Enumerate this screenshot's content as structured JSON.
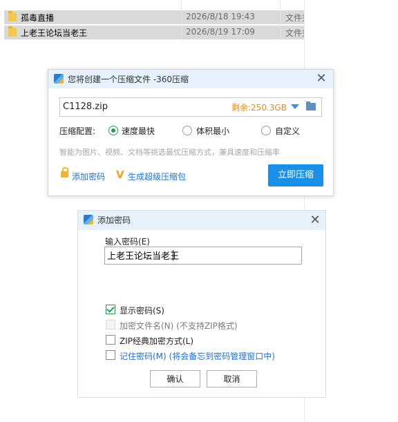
{
  "file_list": {
    "rows": [
      {
        "name": "孤毒直播",
        "date": "2026/8/18 19:43",
        "type": "文件夹"
      },
      {
        "name": "上老王论坛当老王",
        "date": "2026/8/19 17:09",
        "type": "文件夹"
      }
    ]
  },
  "compress_dialog": {
    "title": "您将创建一个压缩文件 -360压缩",
    "filename": "C1128.zip",
    "space_left": "剩余:250.3GB",
    "config_label": "压缩配置:",
    "options": [
      {
        "label": "速度最快",
        "selected": true
      },
      {
        "label": "体积最小",
        "selected": false
      },
      {
        "label": "自定义",
        "selected": false
      }
    ],
    "hint": "智能为图片、视频、文档等挑选最优压缩方式，兼具速度和压缩率",
    "add_password_link": "添加密码",
    "super_pack_link": "生成超级压缩包",
    "compress_button": "立即压缩",
    "colors": {
      "accent": "#1a8fe8",
      "space": "#e88a1a",
      "radio": "#1aa34a"
    }
  },
  "password_dialog": {
    "title": "添加密码",
    "input_label": "输入密码(E)",
    "password_value": "上老王论坛当老王",
    "checkboxes": [
      {
        "label": "显示密码(S)",
        "checked": true,
        "disabled": false
      },
      {
        "label": "加密文件名(N) (不支持ZIP格式)",
        "checked": false,
        "disabled": true
      },
      {
        "label": "ZIP经典加密方式(L)",
        "checked": false,
        "disabled": false
      },
      {
        "label": "记住密码(M) (将会备忘到密码管理窗口中)",
        "checked": false,
        "disabled": false
      }
    ],
    "ok_button": "确认",
    "cancel_button": "取消"
  }
}
